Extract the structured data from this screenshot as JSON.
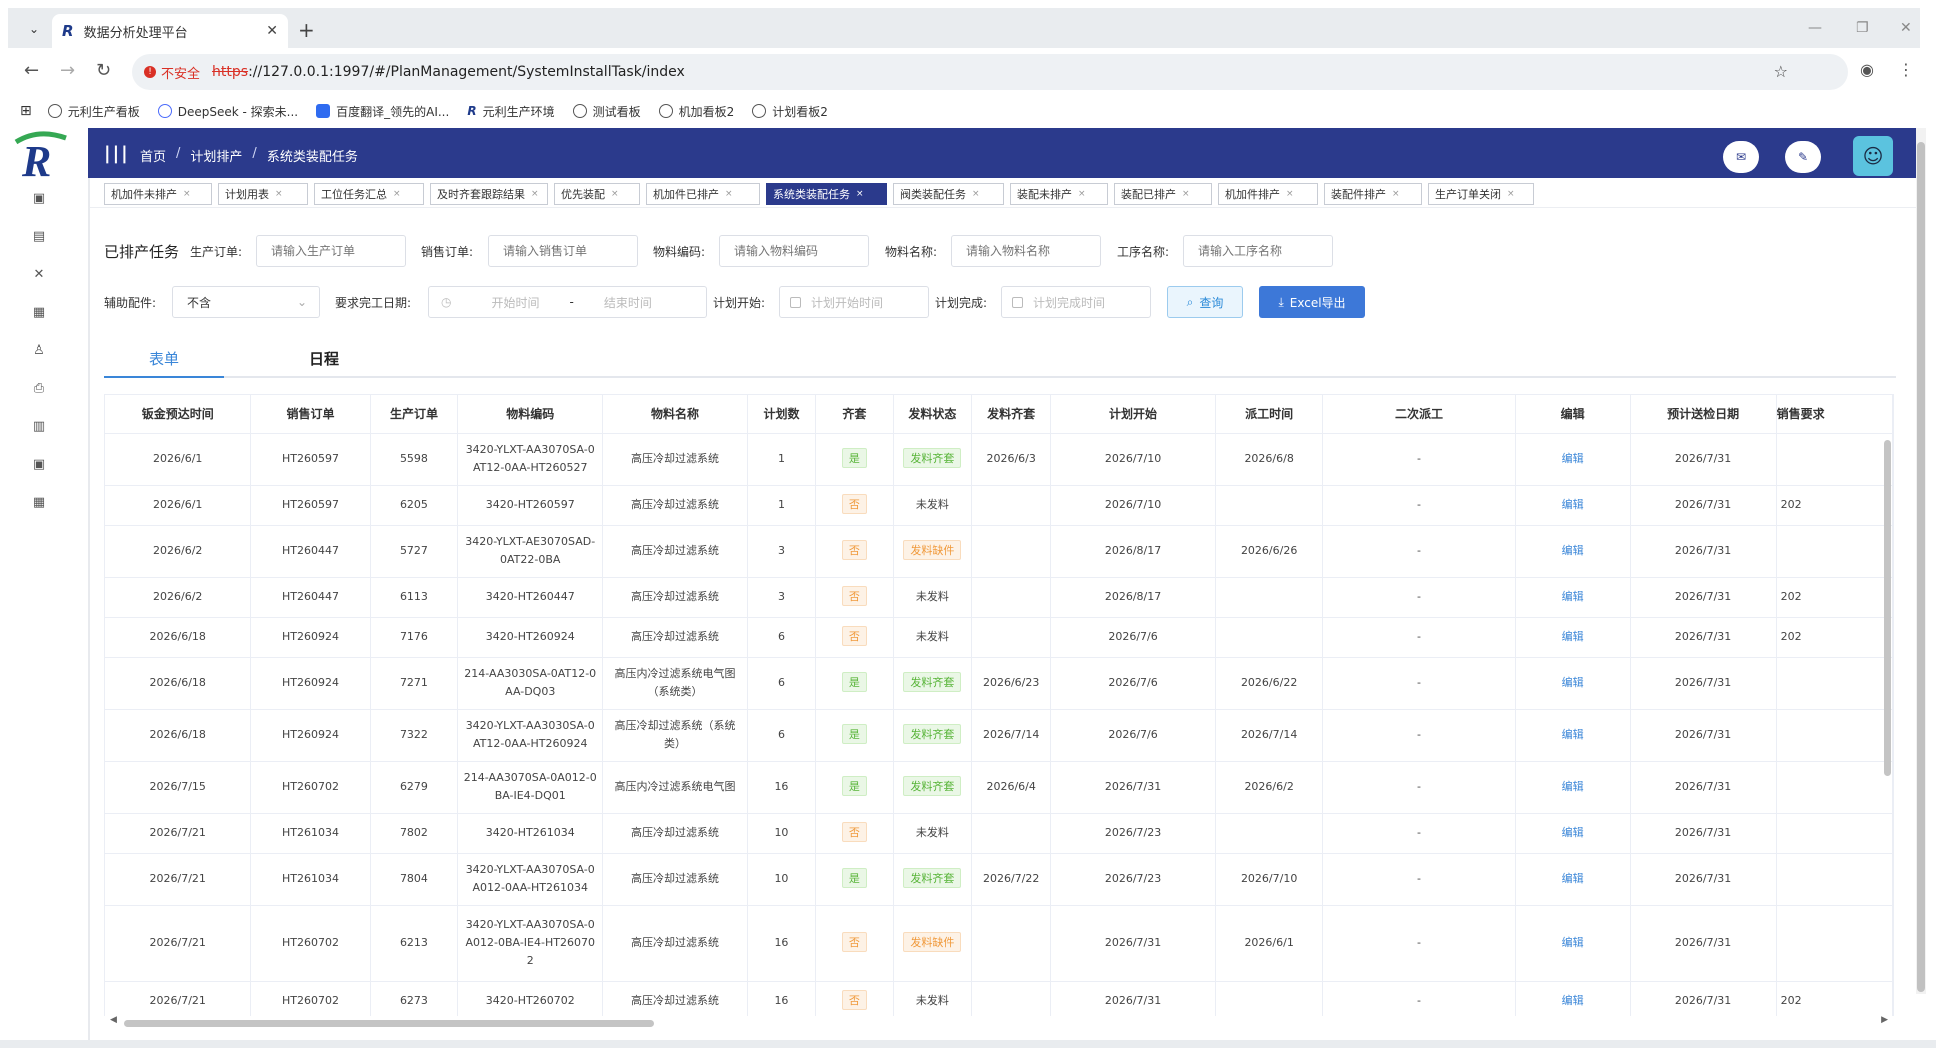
{
  "browser": {
    "tab_title": "数据分析处理平台",
    "insecure_label": "不安全",
    "url_scheme": "https",
    "url_rest": "://127.0.0.1:1997/#/PlanManagement/SystemInstallTask/index",
    "bookmarks": [
      "元利生产看板",
      "DeepSeek - 探索未...",
      "百度翻译_领先的AI...",
      "元利生产环境",
      "测试看板",
      "机加看板2",
      "计划看板2"
    ]
  },
  "app": {
    "breadcrumb": [
      "首页",
      "计划排产",
      "系统类装配任务"
    ],
    "tags": [
      "机加件未排产",
      "计划用表",
      "工位任务汇总",
      "及时齐套跟踪结果",
      "优先装配",
      "机加件已排产",
      "系统类装配任务",
      "阀类装配任务",
      "装配未排产",
      "装配已排产",
      "机加件排产",
      "装配件排产",
      "生产订单关闭"
    ],
    "active_tag": "系统类装配任务",
    "tag_close": "×"
  },
  "filters": {
    "section_title": "已排产任务",
    "prod_order_label": "生产订单:",
    "prod_order_placeholder": "请输入生产订单",
    "sales_order_label": "销售订单:",
    "sales_order_placeholder": "请输入销售订单",
    "material_code_label": "物料编码:",
    "material_code_placeholder": "请输入物料编码",
    "material_name_label": "物料名称:",
    "material_name_placeholder": "请输入物料名称",
    "process_label": "工序名称:",
    "process_placeholder": "请输入工序名称",
    "aux_label": "辅助配件:",
    "aux_value": "不含",
    "due_label": "要求完工日期:",
    "due_start": "开始时间",
    "due_sep": "-",
    "due_end": "结束时间",
    "plan_start_label": "计划开始:",
    "plan_start_placeholder": "计划开始时间",
    "plan_done_label": "计划完成:",
    "plan_done_placeholder": "计划完成时间",
    "search_btn": "查询",
    "export_btn": "Excel导出"
  },
  "view_tabs": [
    "表单",
    "日程"
  ],
  "table": {
    "headers": [
      "钣金预达时间",
      "销售订单",
      "生产订单",
      "物料编码",
      "物料名称",
      "计划数",
      "齐套",
      "发料状态",
      "发料齐套",
      "计划开始",
      "派工时间",
      "二次派工",
      "编辑",
      "预计送检日期",
      "销售要求"
    ],
    "rows": [
      [
        "2026/6/1",
        "HT260597",
        "5598",
        "3420-YLXT-AA3070SA-0AT12-0AA-HT260527",
        "高压冷却过滤系统",
        "1",
        "是",
        "发料齐套",
        "2026/6/3",
        "2026/7/10",
        "2026/6/8",
        "-",
        "编辑",
        "2026/7/31",
        ""
      ],
      [
        "2026/6/1",
        "HT260597",
        "6205",
        "3420-HT260597",
        "高压冷却过滤系统",
        "1",
        "否",
        "未发料",
        "",
        "2026/7/10",
        "",
        "-",
        "编辑",
        "2026/7/31",
        "202"
      ],
      [
        "2026/6/2",
        "HT260447",
        "5727",
        "3420-YLXT-AE3070SAD-0AT22-0BA",
        "高压冷却过滤系统",
        "3",
        "否",
        "发料缺件",
        "",
        "2026/8/17",
        "2026/6/26",
        "-",
        "编辑",
        "2026/7/31",
        ""
      ],
      [
        "2026/6/2",
        "HT260447",
        "6113",
        "3420-HT260447",
        "高压冷却过滤系统",
        "3",
        "否",
        "未发料",
        "",
        "2026/8/17",
        "",
        "-",
        "编辑",
        "2026/7/31",
        "202"
      ],
      [
        "2026/6/18",
        "HT260924",
        "7176",
        "3420-HT260924",
        "高压冷却过滤系统",
        "6",
        "否",
        "未发料",
        "",
        "2026/7/6",
        "",
        "-",
        "编辑",
        "2026/7/31",
        "202"
      ],
      [
        "2026/6/18",
        "HT260924",
        "7271",
        "214-AA3030SA-0AT12-0AA-DQ03",
        "高压内冷过滤系统电气图（系统类）",
        "6",
        "是",
        "发料齐套",
        "2026/6/23",
        "2026/7/6",
        "2026/6/22",
        "-",
        "编辑",
        "2026/7/31",
        ""
      ],
      [
        "2026/6/18",
        "HT260924",
        "7322",
        "3420-YLXT-AA3030SA-0AT12-0AA-HT260924",
        "高压冷却过滤系统（系统类）",
        "6",
        "是",
        "发料齐套",
        "2026/7/14",
        "2026/7/6",
        "2026/7/14",
        "-",
        "编辑",
        "2026/7/31",
        ""
      ],
      [
        "2026/7/15",
        "HT260702",
        "6279",
        "214-AA3070SA-0A012-0BA-IE4-DQ01",
        "高压内冷过滤系统电气图",
        "16",
        "是",
        "发料齐套",
        "2026/6/4",
        "2026/7/31",
        "2026/6/2",
        "-",
        "编辑",
        "2026/7/31",
        ""
      ],
      [
        "2026/7/21",
        "HT261034",
        "7802",
        "3420-HT261034",
        "高压冷却过滤系统",
        "10",
        "否",
        "未发料",
        "",
        "2026/7/23",
        "",
        "-",
        "编辑",
        "2026/7/31",
        ""
      ],
      [
        "2026/7/21",
        "HT261034",
        "7804",
        "3420-YLXT-AA3070SA-0A012-0AA-HT261034",
        "高压冷却过滤系统",
        "10",
        "是",
        "发料齐套",
        "2026/7/22",
        "2026/7/23",
        "2026/7/10",
        "-",
        "编辑",
        "2026/7/31",
        ""
      ],
      [
        "2026/7/21",
        "HT260702",
        "6213",
        "3420-YLXT-AA3070SA-0A012-0BA-IE4-HT260702",
        "高压冷却过滤系统",
        "16",
        "否",
        "发料缺件",
        "",
        "2026/7/31",
        "2026/6/1",
        "-",
        "编辑",
        "2026/7/31",
        ""
      ],
      [
        "2026/7/21",
        "HT260702",
        "6273",
        "3420-HT260702",
        "高压冷却过滤系统",
        "16",
        "否",
        "未发料",
        "",
        "2026/7/31",
        "",
        "-",
        "编辑",
        "2026/7/31",
        "202"
      ]
    ]
  }
}
